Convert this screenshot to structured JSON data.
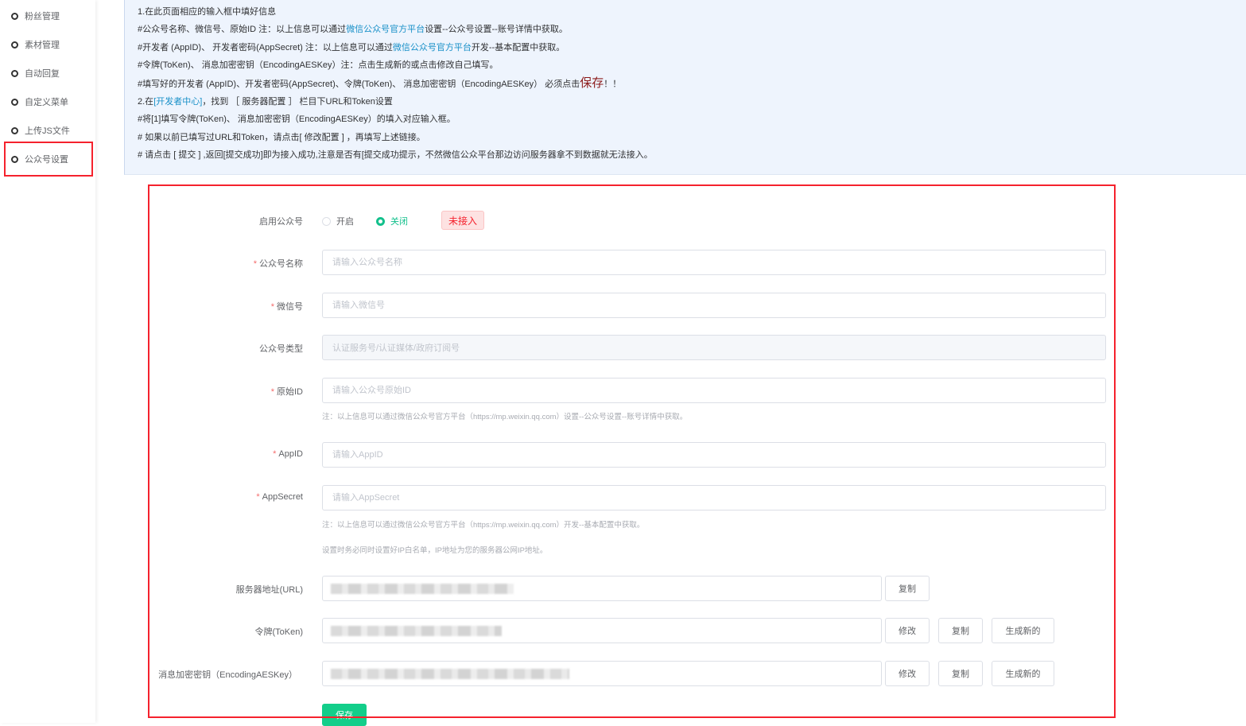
{
  "sidebar": {
    "items": [
      {
        "label": "粉丝管理"
      },
      {
        "label": "素材管理"
      },
      {
        "label": "自动回复"
      },
      {
        "label": "自定义菜单"
      },
      {
        "label": "上传JS文件"
      },
      {
        "label": "公众号设置"
      }
    ]
  },
  "info": {
    "l1": "1.在此页面相应的输入框中填好信息",
    "l2a": "#公众号名称、微信号、原始ID 注：以上信息可以通过",
    "l2link": "微信公众号官方平台",
    "l2b": "设置--公众号设置--账号详情中获取。",
    "l3a": "#开发者 (AppID)、 开发者密码(AppSecret) 注：以上信息可以通过",
    "l3link": "微信公众号官方平台",
    "l3b": "开发--基本配置中获取。",
    "l4": "#令牌(ToKen)、 消息加密密钥（EncodingAESKey）注：点击生成新的或点击修改自己填写。",
    "l5a": "#填写好的开发者 (AppID)、开发者密码(AppSecret)、令牌(ToKen)、 消息加密密钥（EncodingAESKey） 必须点击",
    "l5big": "保存",
    "l5b": "！！",
    "l6a": "2.在",
    "l6link": "[开发者中心]",
    "l6b": "，找到 ［ 服务器配置 ］ 栏目下URL和Token设置",
    "l7": "#将[1]填写令牌(ToKen)、 消息加密密钥（EncodingAESKey）的填入对应输入框。",
    "l8": "# 如果以前已填写过URL和Token，请点击[ 修改配置 ] ，再填写上述链接。",
    "l9": "# 请点击 [ 提交 ] ,返回[提交成功]即为接入成功,注意是否有[提交成功提示，不然微信公众平台那边访问服务器拿不到数据就无法接入。"
  },
  "form": {
    "enable_label": "启用公众号",
    "radio_on": "开启",
    "radio_off": "关闭",
    "status_tag": "未接入",
    "name_label": "公众号名称",
    "name_placeholder": "请输入公众号名称",
    "wechat_label": "微信号",
    "wechat_placeholder": "请输入微信号",
    "type_label": "公众号类型",
    "type_value": "认证服务号/认证媒体/政府订阅号",
    "origid_label": "原始ID",
    "origid_placeholder": "请输入公众号原始ID",
    "note1": "注：以上信息可以通过微信公众号官方平台（https://mp.weixin.qq.com）设置--公众号设置--账号详情中获取。",
    "appid_label": "AppID",
    "appid_placeholder": "请输入AppID",
    "secret_label": "AppSecret",
    "secret_placeholder": "请输入AppSecret",
    "note2": "注：以上信息可以通过微信公众号官方平台（https://mp.weixin.qq.com）开发--基本配置中获取。",
    "note3": "设置时务必同时设置好IP白名单，IP地址为您的服务器公网IP地址。",
    "url_label": "服务器地址(URL)",
    "token_label": "令牌(ToKen)",
    "aes_label": "消息加密密钥（EncodingAESKey）",
    "copy": "复制",
    "modify": "修改",
    "generate": "生成新的",
    "save": "保存"
  }
}
